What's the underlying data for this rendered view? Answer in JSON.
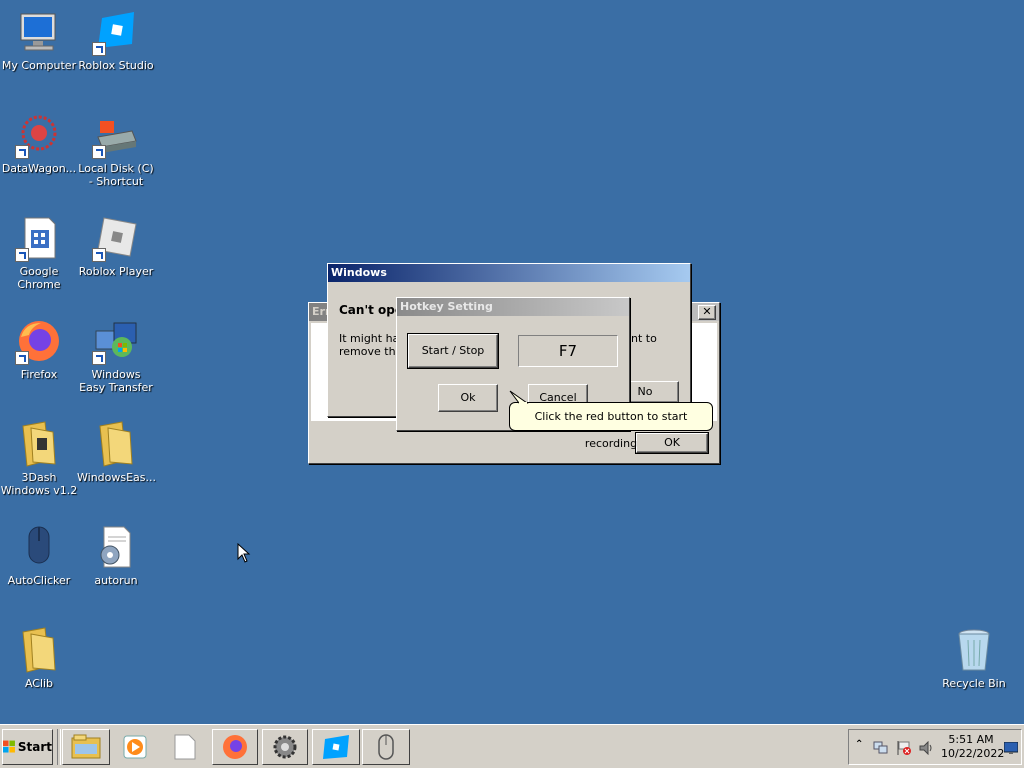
{
  "desktop": {
    "icons": [
      {
        "label": "My Computer"
      },
      {
        "label": "Roblox Studio"
      },
      {
        "label": "DataWagon..."
      },
      {
        "label": "Local Disk (C) - Shortcut"
      },
      {
        "label": "Google Chrome"
      },
      {
        "label": "Roblox Player"
      },
      {
        "label": "Firefox"
      },
      {
        "label": "Windows Easy Transfer"
      },
      {
        "label": "3Dash Windows v1.2"
      },
      {
        "label": "WindowsEas..."
      },
      {
        "label": "AutoClicker"
      },
      {
        "label": "autorun"
      },
      {
        "label": "AClib"
      },
      {
        "label": "Recycle Bin"
      }
    ]
  },
  "error_dialog": {
    "title": "Err",
    "ok_label": "OK"
  },
  "windows_dialog": {
    "title": "Windows",
    "heading": "Can't oper",
    "body_left": "It might hav\nremove this",
    "body_right": "nt to",
    "no_label": "No"
  },
  "hotkey_dialog": {
    "title": "Hotkey Setting",
    "start_stop_label": "Start / Stop",
    "hotkey_value": "F7",
    "ok_label": "Ok",
    "cancel_label": "Cancel"
  },
  "tooltip": {
    "text": "Click the red button to start recording"
  },
  "taskbar": {
    "start_label": "Start",
    "clock_time": "5:51 AM",
    "clock_date": "10/22/2022"
  },
  "colors": {
    "desktop": "#3a6ea5",
    "active_title": "#0a246a",
    "inactive_title": "#808080"
  }
}
